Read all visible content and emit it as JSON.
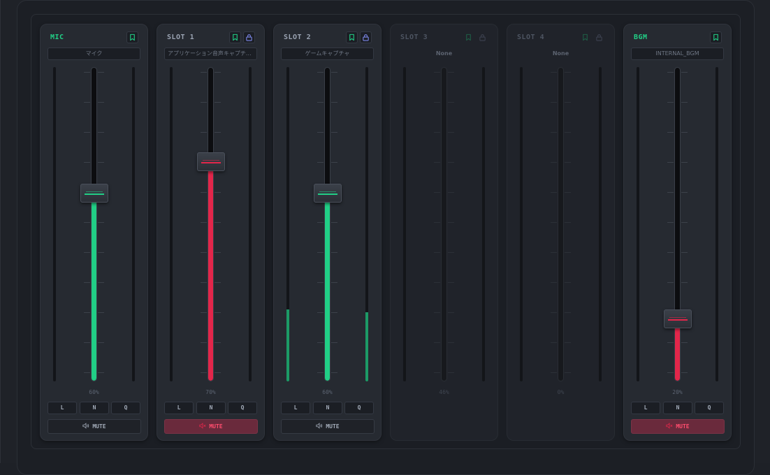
{
  "colors": {
    "accent_green": "#21cf86",
    "meter_green": "#1c9a66",
    "fader_red": "#e3264a",
    "lock_blue": "#7b86e8",
    "mute_active_bg": "#6a2a3c"
  },
  "icons": {
    "header_left": "bookmark-icon",
    "header_right": "lock-icon",
    "mute": "speaker-icon",
    "mute_active": "speaker-muted-icon"
  },
  "eq_buttons": [
    "L",
    "N",
    "Q"
  ],
  "channels": [
    {
      "id": "mic",
      "name": "MIC",
      "source": "マイク",
      "level": 0.6,
      "level_label": "60%",
      "fader_color": "green",
      "meter_left": 0,
      "meter_right": 0,
      "has_lock": false,
      "mute_label": "MUTE",
      "muted": false,
      "enabled": true,
      "name_accent": true
    },
    {
      "id": "slot1",
      "name": "SLOT 1",
      "source": "アプリケーション音声キャプチャ...",
      "level": 0.7,
      "level_label": "70%",
      "fader_color": "red",
      "meter_left": 0,
      "meter_right": 0,
      "has_lock": true,
      "mute_label": "MUTE",
      "muted": true,
      "enabled": true,
      "name_accent": false
    },
    {
      "id": "slot2",
      "name": "SLOT 2",
      "source": "ゲームキャプチャ",
      "level": 0.6,
      "level_label": "60%",
      "fader_color": "green",
      "meter_left": 0.23,
      "meter_right": 0.22,
      "has_lock": true,
      "mute_label": "MUTE",
      "muted": false,
      "enabled": true,
      "name_accent": false
    },
    {
      "id": "slot3",
      "name": "SLOT 3",
      "source": "None",
      "level": 0.46,
      "level_label": "46%",
      "fader_color": "none",
      "meter_left": 0,
      "meter_right": 0,
      "has_lock": true,
      "mute_label": "",
      "muted": false,
      "enabled": false,
      "name_accent": false
    },
    {
      "id": "slot4",
      "name": "SLOT 4",
      "source": "None",
      "level": 0,
      "level_label": "0%",
      "fader_color": "none",
      "meter_left": 0,
      "meter_right": 0,
      "has_lock": true,
      "mute_label": "",
      "muted": false,
      "enabled": false,
      "name_accent": false
    },
    {
      "id": "bgm",
      "name": "BGM",
      "source": "INTERNAL_BGM",
      "level": 0.2,
      "level_label": "20%",
      "fader_color": "red",
      "meter_left": 0,
      "meter_right": 0,
      "has_lock": false,
      "mute_label": "MUTE",
      "muted": true,
      "enabled": true,
      "name_accent": true
    }
  ]
}
